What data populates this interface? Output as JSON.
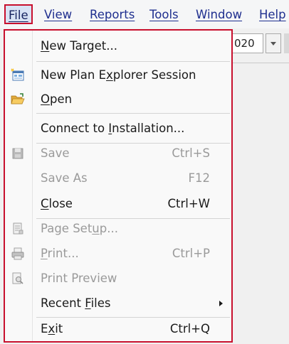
{
  "menubar": {
    "items": [
      {
        "label": "File",
        "mnemonic_index": 0
      },
      {
        "label": "View",
        "mnemonic_index": 0
      },
      {
        "label": "Reports",
        "mnemonic_index": 0
      },
      {
        "label": "Tools",
        "mnemonic_index": 0
      },
      {
        "label": "Window",
        "mnemonic_index": 0
      },
      {
        "label": "Help",
        "mnemonic_index": 0
      }
    ]
  },
  "toolbar": {
    "combo_value": "020"
  },
  "file_menu": {
    "items": [
      {
        "label": "New Target...",
        "ul": 0,
        "shortcut": "",
        "enabled": true,
        "icon": ""
      },
      {
        "label": "New Plan Explorer Session",
        "ul": 10,
        "shortcut": "",
        "enabled": true,
        "icon": "plan-explorer-icon"
      },
      {
        "label": "Open",
        "ul": 0,
        "shortcut": "",
        "enabled": true,
        "icon": "open-folder-icon"
      },
      {
        "label": "Connect to Installation...",
        "ul": 11,
        "shortcut": "",
        "enabled": true,
        "icon": ""
      },
      {
        "label": "Save",
        "ul": -1,
        "shortcut": "Ctrl+S",
        "enabled": false,
        "icon": "save-disk-icon"
      },
      {
        "label": "Save As",
        "ul": -1,
        "shortcut": "F12",
        "enabled": false,
        "icon": ""
      },
      {
        "label": "Close",
        "ul": 0,
        "shortcut": "Ctrl+W",
        "enabled": true,
        "icon": ""
      },
      {
        "label": "Page Setup...",
        "ul": 8,
        "shortcut": "",
        "enabled": false,
        "icon": "page-setup-icon"
      },
      {
        "label": "Print...",
        "ul": 0,
        "shortcut": "Ctrl+P",
        "enabled": false,
        "icon": "printer-icon"
      },
      {
        "label": "Print Preview",
        "ul": -1,
        "shortcut": "",
        "enabled": false,
        "icon": "print-preview-icon"
      },
      {
        "label": "Recent Files",
        "ul": 7,
        "shortcut": "",
        "enabled": true,
        "icon": "",
        "submenu": true
      },
      {
        "label": "Exit",
        "ul": 1,
        "shortcut": "Ctrl+Q",
        "enabled": true,
        "icon": ""
      }
    ]
  },
  "colors": {
    "highlight_border": "#c8102e",
    "menubar_text": "#1f2f8f",
    "disabled_text": "#9a9a9a"
  }
}
